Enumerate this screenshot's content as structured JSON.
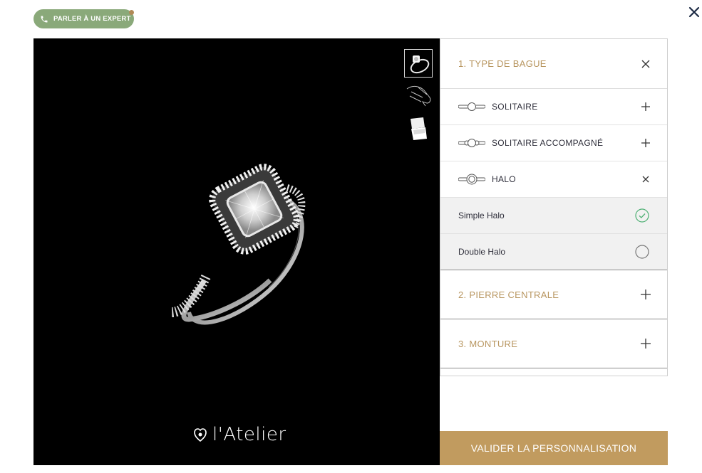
{
  "expert_button": {
    "label": "PARLER À UN EXPERT"
  },
  "viewer": {
    "thumbnails": [
      {
        "name": "ring-view",
        "active": true
      },
      {
        "name": "hand-view",
        "active": false
      },
      {
        "name": "box-view",
        "active": false
      }
    ],
    "logo_text": "l'Atelier"
  },
  "panel": {
    "section1": {
      "title": "1. TYPE DE BAGUE"
    },
    "ring_types": [
      {
        "label": "SOLITAIRE",
        "state": "collapsed"
      },
      {
        "label": "SOLITAIRE ACCOMPAGNÉ",
        "state": "collapsed"
      },
      {
        "label": "HALO",
        "state": "expanded"
      }
    ],
    "halo_options": [
      {
        "label": "Simple Halo",
        "selected": true
      },
      {
        "label": "Double Halo",
        "selected": false
      }
    ],
    "section2": {
      "title": "2. PIERRE CENTRALE"
    },
    "section3": {
      "title": "3. MONTURE"
    }
  },
  "validate_button": {
    "label": "VALIDER LA PERSONNALISATION"
  },
  "colors": {
    "gold": "#b89660",
    "button_gold": "#c19b5f",
    "green_pill": "#8aa97a",
    "check_green": "#4caf72"
  }
}
